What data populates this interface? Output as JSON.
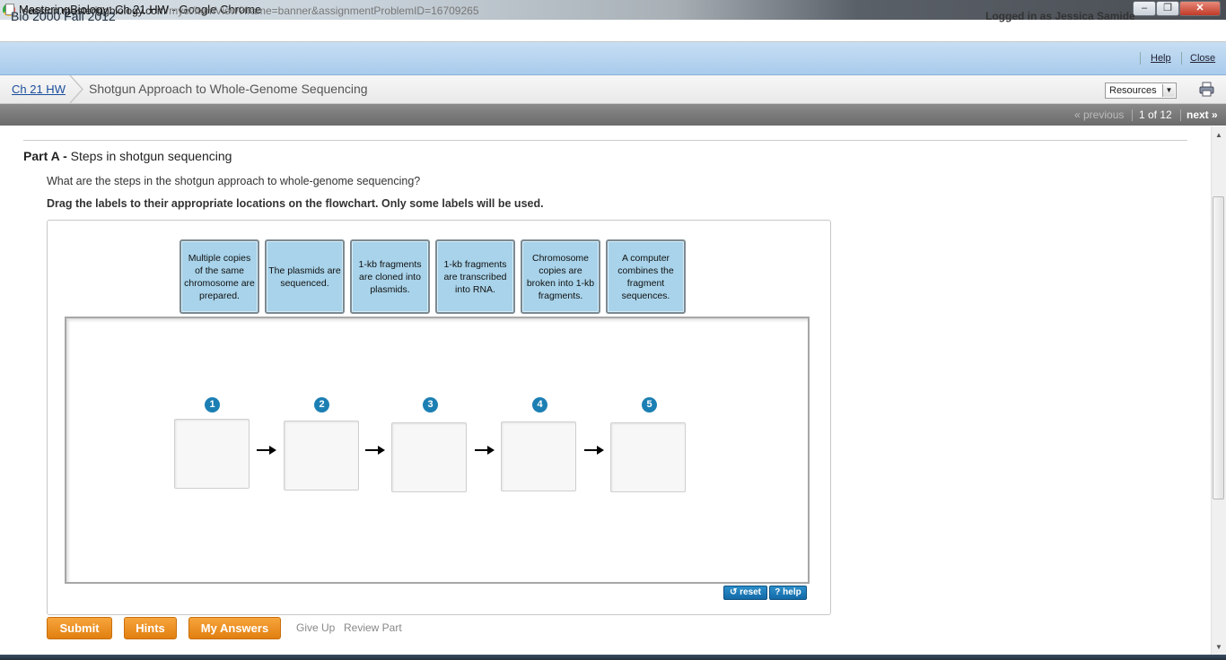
{
  "window": {
    "title": "MasteringBiology: Ch 21 HW - Google Chrome",
    "minimize": "–",
    "maximize": "❐",
    "close": "✕"
  },
  "address": {
    "host": "session.masteringbiology.com",
    "path": "/myct/itemView?frame=banner&assignmentProblemID=16709265"
  },
  "course_bar": {
    "course_title": "Bio 2000 Fall 2012",
    "logged_in": "Logged in as Jessica Samide",
    "help": "Help",
    "close": "Close"
  },
  "breadcrumb": {
    "assignment": "Ch 21 HW",
    "problem_title": "Shotgun Approach to Whole-Genome Sequencing",
    "resources_select": "Resources",
    "print_icon": "printer-icon"
  },
  "nav": {
    "previous": "« previous",
    "count": "1 of 12",
    "next": "next »"
  },
  "part": {
    "label": "Part A -",
    "title": "Steps in shotgun sequencing",
    "question": "What are the steps in the shotgun approach to whole-genome sequencing?",
    "instruction": "Drag the labels to their appropriate locations on the flowchart. Only some labels will be used."
  },
  "labels": [
    "Multiple copies of the same chromosome are prepared.",
    "The plasmids are sequenced.",
    "1-kb fragments are cloned into plasmids.",
    "1-kb fragments are transcribed into RNA.",
    "Chromosome copies are broken into 1-kb fragments.",
    "A computer combines the fragment sequences."
  ],
  "steps": [
    "1",
    "2",
    "3",
    "4",
    "5"
  ],
  "widget_buttons": {
    "reset": "↺ reset",
    "help": "? help"
  },
  "actions": {
    "submit": "Submit",
    "hints": "Hints",
    "my_answers": "My Answers",
    "give_up": "Give Up",
    "review_part": "Review Part"
  },
  "colors": {
    "label_card": "#a8d3ea",
    "step_badge": "#1c7fb3",
    "action_button": "#f39a2d"
  }
}
